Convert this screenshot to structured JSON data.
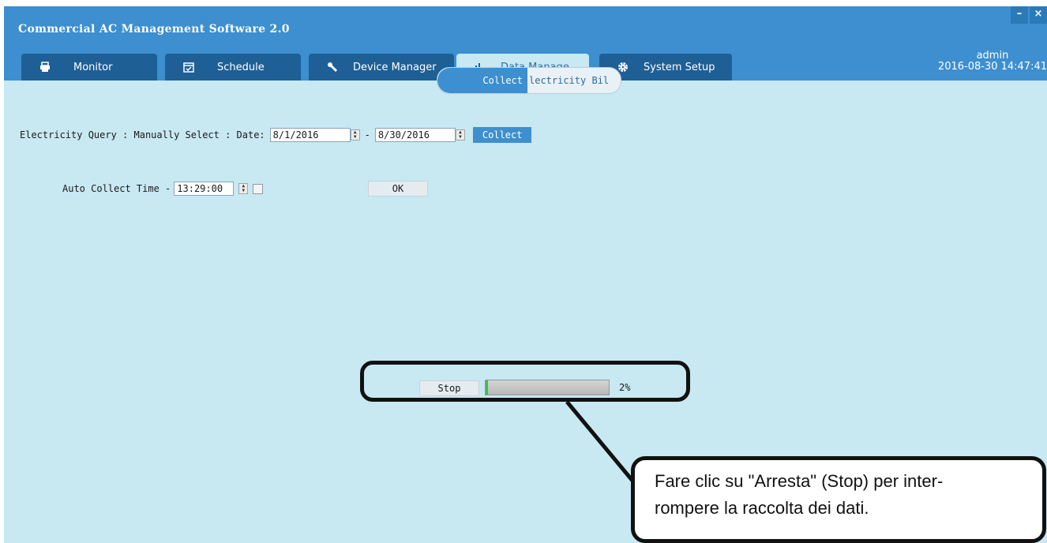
{
  "app": {
    "title": "Commercial AC Management Software 2.0"
  },
  "window_controls": {
    "minimize": "–",
    "close": "×"
  },
  "tabs": [
    {
      "label": "Monitor",
      "icon": "printer-icon"
    },
    {
      "label": "Schedule",
      "icon": "calendar-icon"
    },
    {
      "label": "Device Manager",
      "icon": "wrench-icon"
    },
    {
      "label": "Data Manage",
      "icon": "bar-chart-icon",
      "active": true
    },
    {
      "label": "System Setup",
      "icon": "gear-icon"
    }
  ],
  "user": {
    "name": "admin",
    "datetime": "2016-08-30 14:47:41"
  },
  "subtabs": {
    "collect": "Collect",
    "bill": "lectricity Bil"
  },
  "query": {
    "label": "Electricity  Query : Manually  Select : Date:",
    "date_from": "8/1/2016",
    "separator": "-",
    "date_to": "8/30/2016",
    "collect_button": "Collect"
  },
  "auto": {
    "label": "Auto Collect   Time -",
    "time": "13:29:00",
    "enabled": false,
    "ok_button": "OK"
  },
  "progress": {
    "stop_button": "Stop",
    "percent": 2,
    "text": "2%"
  },
  "callout": {
    "line1": "Fare clic su \"Arresta\" (Stop) per inter-",
    "line2": "rompere la raccolta dei dati."
  },
  "colors": {
    "header": "#3d8fcf",
    "tab": "#1e5f96",
    "content": "#c8e8f2",
    "progress": "#3cbf4a"
  }
}
